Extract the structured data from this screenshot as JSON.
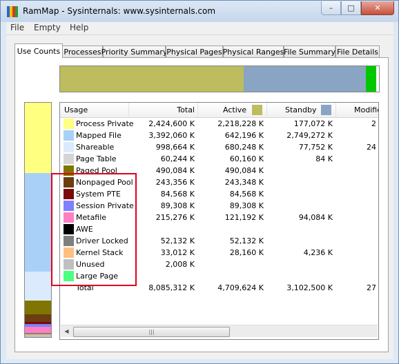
{
  "window": {
    "title": "RamMap - Sysinternals: www.sysinternals.com",
    "minimize_glyph": "–",
    "maximize_glyph": "□",
    "close_glyph": "✕"
  },
  "menu": [
    "File",
    "Empty",
    "Help"
  ],
  "tabs": [
    "Use Counts",
    "Processes",
    "Priority Summary",
    "Physical Pages",
    "Physical Ranges",
    "File Summary",
    "File Details"
  ],
  "columns": {
    "usage": "Usage",
    "total": "Total",
    "active": "Active",
    "standby": "Standby",
    "modified": "Modifie"
  },
  "colors": {
    "active": "#bdbc5e",
    "standby": "#8aa4c3",
    "green": "#00c800",
    "highlight_box": "#e0001b"
  },
  "rows": [
    {
      "label": "Process Private",
      "color": "#ffff80",
      "total": "2,424,600 K",
      "active": "2,218,228 K",
      "standby": "177,072 K",
      "modified": "2"
    },
    {
      "label": "Mapped File",
      "color": "#a9d1f7",
      "total": "3,392,060 K",
      "active": "642,196 K",
      "standby": "2,749,272 K",
      "modified": ""
    },
    {
      "label": "Shareable",
      "color": "#dbeafc",
      "total": "998,664 K",
      "active": "680,248 K",
      "standby": "77,752 K",
      "modified": "24"
    },
    {
      "label": "Page Table",
      "color": "#d5d5d5",
      "total": "60,244 K",
      "active": "60,160 K",
      "standby": "84 K",
      "modified": ""
    },
    {
      "label": "Paged Pool",
      "color": "#7f7500",
      "total": "490,084 K",
      "active": "490,084 K",
      "standby": "",
      "modified": ""
    },
    {
      "label": "Nonpaged Pool",
      "color": "#6b3d10",
      "total": "243,356 K",
      "active": "243,348 K",
      "standby": "",
      "modified": ""
    },
    {
      "label": "System PTE",
      "color": "#7a0a0a",
      "total": "84,568 K",
      "active": "84,568 K",
      "standby": "",
      "modified": ""
    },
    {
      "label": "Session Private",
      "color": "#7f7fff",
      "total": "89,308 K",
      "active": "89,308 K",
      "standby": "",
      "modified": ""
    },
    {
      "label": "Metafile",
      "color": "#ff80c0",
      "total": "215,276 K",
      "active": "121,192 K",
      "standby": "94,084 K",
      "modified": ""
    },
    {
      "label": "AWE",
      "color": "#000000",
      "total": "",
      "active": "",
      "standby": "",
      "modified": ""
    },
    {
      "label": "Driver Locked",
      "color": "#7f7f7f",
      "total": "52,132 K",
      "active": "52,132 K",
      "standby": "",
      "modified": ""
    },
    {
      "label": "Kernel Stack",
      "color": "#ffbf80",
      "total": "33,012 K",
      "active": "28,160 K",
      "standby": "4,236 K",
      "modified": ""
    },
    {
      "label": "Unused",
      "color": "#c0c0c0",
      "total": "2,008 K",
      "active": "",
      "standby": "",
      "modified": ""
    },
    {
      "label": "Large Page",
      "color": "#4dff80",
      "total": "",
      "active": "",
      "standby": "",
      "modified": ""
    },
    {
      "label": "Total",
      "color": "",
      "total": "8,085,312 K",
      "active": "4,709,624 K",
      "standby": "3,102,500 K",
      "modified": "27"
    }
  ],
  "topbar_segments": [
    {
      "color": "#bdbc5e",
      "fraction": 0.576
    },
    {
      "color": "#8aa4c3",
      "fraction": 0.382
    },
    {
      "color": "#00c800",
      "fraction": 0.034
    },
    {
      "color": "#ffffff",
      "fraction": 0.008
    }
  ],
  "sidebar_segments": [
    {
      "color": "#ffff80",
      "fraction": 0.3
    },
    {
      "color": "#a9d1f7",
      "fraction": 0.42
    },
    {
      "color": "#dbeafc",
      "fraction": 0.12
    },
    {
      "color": "#f0f0f0",
      "fraction": 0.003
    },
    {
      "color": "#7f7500",
      "fraction": 0.061
    },
    {
      "color": "#6b3d10",
      "fraction": 0.03
    },
    {
      "color": "#7a0a0a",
      "fraction": 0.01
    },
    {
      "color": "#7f7fff",
      "fraction": 0.011
    },
    {
      "color": "#ff80c0",
      "fraction": 0.027
    },
    {
      "color": "#7f7f7f",
      "fraction": 0.006
    },
    {
      "color": "#ffbf80",
      "fraction": 0.004
    },
    {
      "color": "#c0c0c0",
      "fraction": 0.008
    }
  ],
  "scrollbar": {
    "left_arrow": "◀",
    "grip": "|||"
  }
}
